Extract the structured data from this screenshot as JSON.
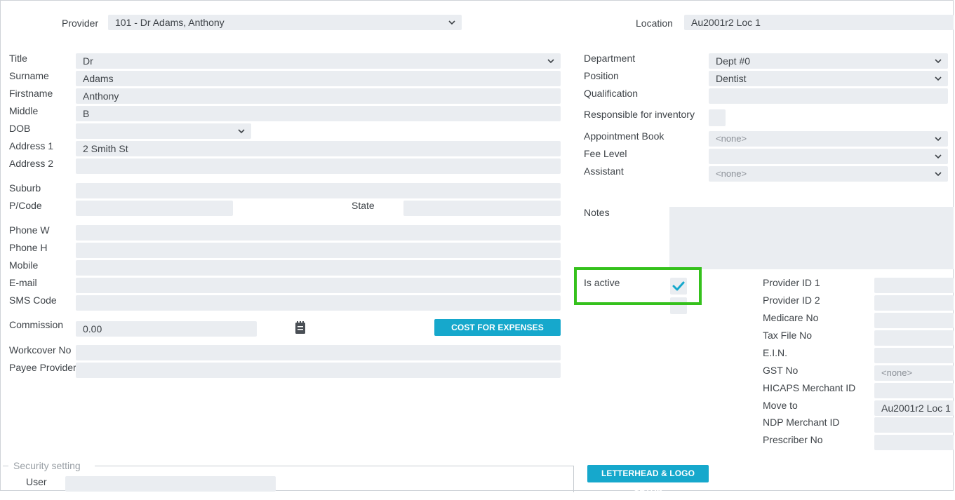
{
  "header": {
    "provider_label": "Provider",
    "provider_value": "101 - Dr Adams, Anthony",
    "location_label": "Location",
    "location_value": "Au2001r2 Loc 1"
  },
  "left": {
    "title_label": "Title",
    "title_value": "Dr",
    "surname_label": "Surname",
    "surname_value": "Adams",
    "firstname_label": "Firstname",
    "firstname_value": "Anthony",
    "middle_label": "Middle",
    "middle_value": "B",
    "dob_label": "DOB",
    "dob_value": "",
    "address1_label": "Address 1",
    "address1_value": "2 Smith St",
    "address2_label": "Address 2",
    "address2_value": "",
    "suburb_label": "Suburb",
    "suburb_value": "",
    "pcode_label": "P/Code",
    "pcode_value": "",
    "state_label": "State",
    "state_value": "",
    "phonew_label": "Phone W",
    "phonew_value": "",
    "phoneh_label": "Phone H",
    "phoneh_value": "",
    "mobile_label": "Mobile",
    "mobile_value": "",
    "email_label": "E-mail",
    "email_value": "",
    "sms_label": "SMS Code",
    "sms_value": "",
    "commission_label": "Commission",
    "commission_value": "0.00",
    "cost_button": "COST FOR EXPENSES",
    "workcover_label": "Workcover No",
    "workcover_value": "",
    "payee_label": "Payee Provider",
    "payee_value": ""
  },
  "right": {
    "department_label": "Department",
    "department_value": "Dept #0",
    "position_label": "Position",
    "position_value": "Dentist",
    "qualification_label": "Qualification",
    "qualification_value": "",
    "inventory_label": "Responsible for inventory",
    "appt_book_label": "Appointment Book",
    "appt_book_value": "<none>",
    "fee_level_label": "Fee Level",
    "fee_level_value": "",
    "assistant_label": "Assistant",
    "assistant_value": "<none>",
    "notes_label": "Notes",
    "is_active_label": "Is active",
    "is_active_checked": true,
    "letterhead_button": "LETTERHEAD & LOGO SETUP"
  },
  "ids": {
    "provider_id1_label": "Provider ID 1",
    "provider_id1_value": "",
    "provider_id2_label": "Provider ID 2",
    "provider_id2_value": "",
    "medicare_label": "Medicare No",
    "medicare_value": "",
    "tax_label": "Tax File No",
    "tax_value": "",
    "ein_label": "E.I.N.",
    "ein_value": "",
    "gst_label": "GST No",
    "gst_value": "<none>",
    "hicaps_label": "HICAPS Merchant ID",
    "hicaps_value": "",
    "move_label": "Move to",
    "move_value": "Au2001r2 Loc 1",
    "ndp_label": "NDP Merchant ID",
    "ndp_value": "",
    "prescriber_label": "Prescriber No",
    "prescriber_value": ""
  },
  "security": {
    "section_label": "Security setting",
    "user_label": "User",
    "user_value": ""
  },
  "colors": {
    "field_bg": "#eaedf1",
    "accent": "#16a8cc",
    "highlight": "#35c11c"
  }
}
